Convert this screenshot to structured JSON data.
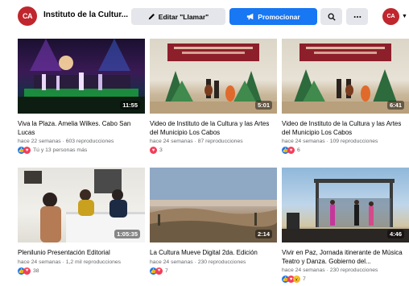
{
  "header": {
    "logo_text": "CA",
    "page_name": "Instituto de la Cultur...",
    "edit_button": "Editar \"Llamar\"",
    "promote_button": "Promocionar",
    "avatar_text": "CA"
  },
  "videos": [
    {
      "duration": "11:55",
      "title": "Viva la Plaza. Amelia Wilkes. Cabo San Lucas",
      "meta": "hace 22 semanas · 603 reproducciones",
      "reactions": "Tú y 13 personas más",
      "reaction_icons": [
        "like",
        "love"
      ]
    },
    {
      "duration": "5:01",
      "title": "Video de Instituto de la Cultura y las Artes del Municipio Los Cabos",
      "meta": "hace 24 semanas · 87 reproducciones",
      "reactions": "3",
      "reaction_icons": [
        "love"
      ]
    },
    {
      "duration": "6:41",
      "title": "Video de Instituto de la Cultura y las Artes del Municipio Los Cabos",
      "meta": "hace 24 semanas · 109 reproducciones",
      "reactions": "6",
      "reaction_icons": [
        "like",
        "love"
      ]
    },
    {
      "duration": "1:05:35",
      "title": "Plenilunio Presentación Editorial",
      "meta": "hace 24 semanas · 1,2 mil reproducciones",
      "reactions": "38",
      "reaction_icons": [
        "like",
        "love"
      ]
    },
    {
      "duration": "2:14",
      "title": "La Cultura Mueve Digital 2da. Edición",
      "meta": "hace 24 semanas · 230 reproducciones",
      "reactions": "7",
      "reaction_icons": [
        "like",
        "love"
      ]
    },
    {
      "duration": "4:46",
      "title": "Vivir en Paz, Jornada itinerante de Música Teatro y Danza. Gobierno del...",
      "meta": "hace 24 semanas · 230 reproducciones",
      "reactions": "7",
      "reaction_icons": [
        "like",
        "love",
        "wow"
      ]
    }
  ],
  "colors": {
    "primary": "#1877f2",
    "secondary_button": "#e4e6eb",
    "brand_red": "#c0262d",
    "meta_text": "#65676b"
  }
}
